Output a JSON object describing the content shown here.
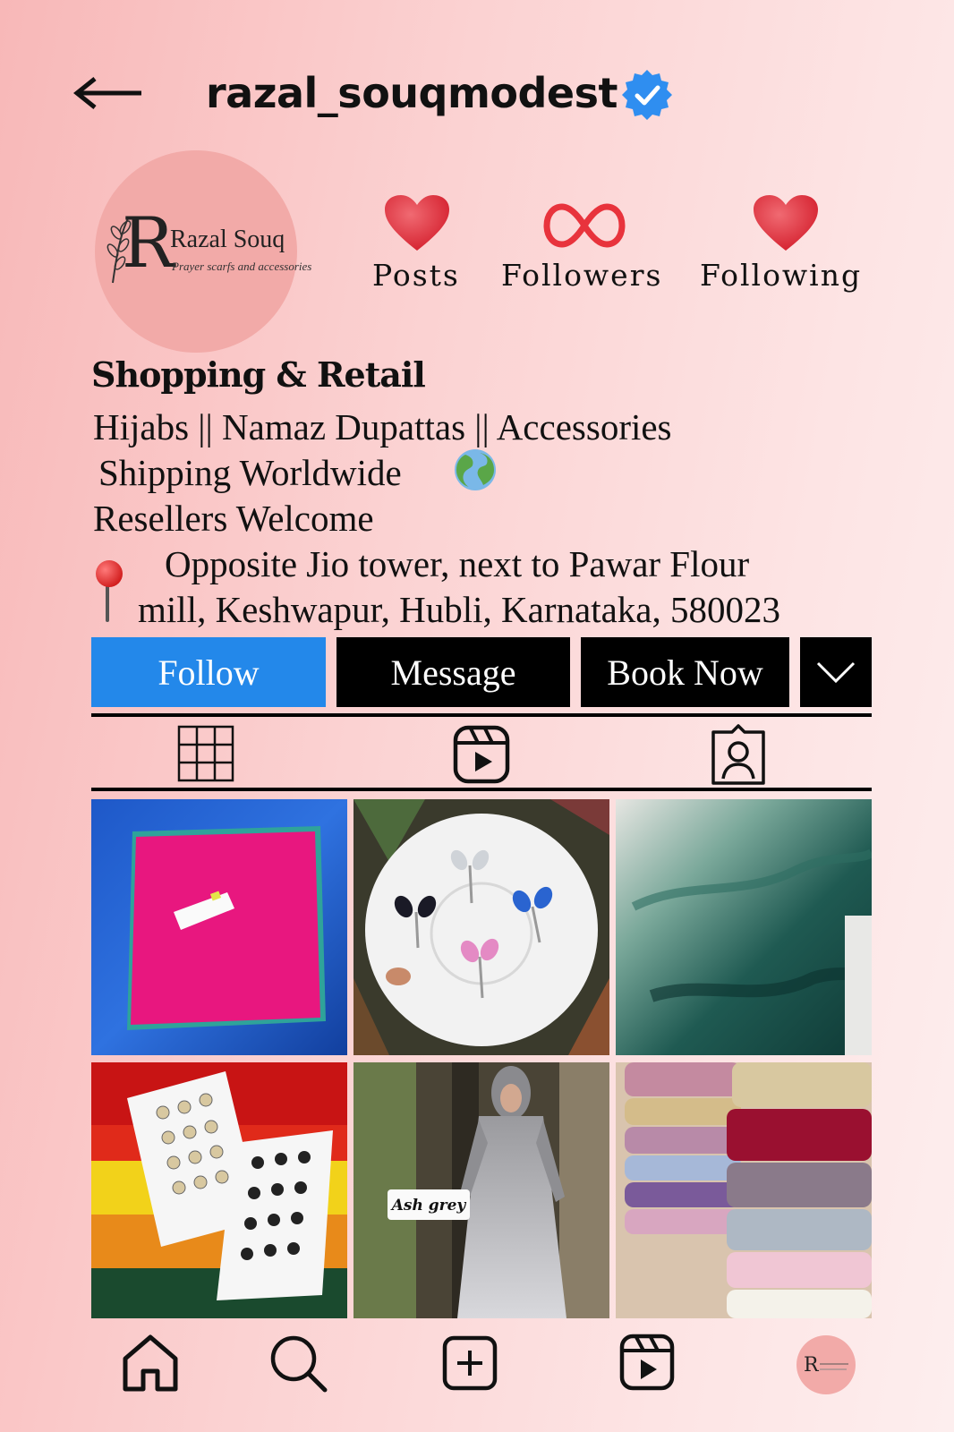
{
  "header": {
    "username": "razal_souqmodest"
  },
  "avatar": {
    "brand_initial": "R",
    "brand_name": "Razal Souq",
    "tagline": "Prayer scarfs and accessories"
  },
  "stats": [
    {
      "label": "Posts",
      "icon": "heart-icon"
    },
    {
      "label": "Followers",
      "icon": "infinity-icon"
    },
    {
      "label": "Following",
      "icon": "heart-icon"
    }
  ],
  "bio": {
    "category": "Shopping & Retail",
    "line1": "Hijabs || Namaz Dupattas || Accessories",
    "line2": "Shipping Worldwide",
    "line3": "Resellers Welcome",
    "address_line1": "Opposite Jio tower, next to Pawar Flour",
    "address_line2": "mill, Keshwapur, Hubli, Karnataka, 580023"
  },
  "buttons": {
    "follow": "Follow",
    "message": "Message",
    "book_now": "Book Now"
  },
  "tabs": [
    "grid-icon",
    "reels-icon",
    "tagged-icon"
  ],
  "posts": [
    {
      "subject": "pink scarf with card"
    },
    {
      "subject": "hijab pins on plate"
    },
    {
      "subject": "green glitter fabric"
    },
    {
      "subject": "hijab pin cards on fabric"
    },
    {
      "subject": "abaya",
      "caption": "Ash grey"
    },
    {
      "subject": "satin scarves stack"
    }
  ],
  "bottom_nav": [
    "home-icon",
    "search-icon",
    "create-icon",
    "reels-icon",
    "profile-avatar"
  ],
  "colors": {
    "follow_blue": "#2388ea",
    "heart_red": "#e0303c",
    "verified_blue": "#2f8ef0"
  }
}
